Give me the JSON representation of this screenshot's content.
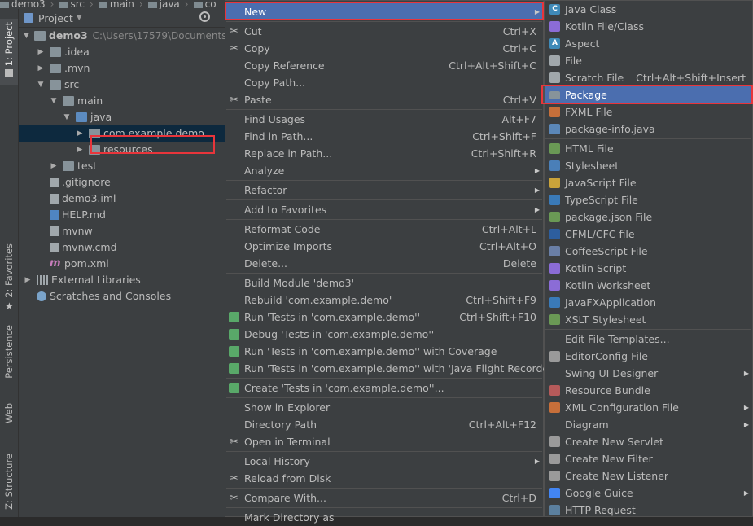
{
  "breadcrumb": [
    "demo3",
    "src",
    "main",
    "java",
    "co"
  ],
  "strip": {
    "project_tab": "1: Project",
    "favorites_tab": "2: Favorites",
    "persistence_tab": "Persistence",
    "web_tab": "Web",
    "structure_tab": "Z: Structure"
  },
  "panel": {
    "title": "Project"
  },
  "tree": [
    {
      "label": "demo3",
      "path": "C:\\Users\\17579\\Documents\\",
      "bold": true,
      "expanded": true,
      "icon": "folder-icon"
    },
    {
      "label": ".idea",
      "expanded": false,
      "icon": "folder-icon"
    },
    {
      "label": ".mvn",
      "expanded": false,
      "icon": "folder-icon"
    },
    {
      "label": "src",
      "expanded": true,
      "icon": "folder-icon"
    },
    {
      "label": "main",
      "expanded": true,
      "icon": "folder-icon"
    },
    {
      "label": "java",
      "expanded": true,
      "icon": "source-folder-icon"
    },
    {
      "label": "com.example.demo",
      "expanded": false,
      "icon": "package-icon",
      "selected": true
    },
    {
      "label": "resources",
      "expanded": false,
      "icon": "resources-folder-icon"
    },
    {
      "label": "test",
      "expanded": false,
      "icon": "folder-icon"
    },
    {
      "label": ".gitignore",
      "icon": "file-icon"
    },
    {
      "label": "demo3.iml",
      "icon": "file-icon"
    },
    {
      "label": "HELP.md",
      "icon": "markdown-icon"
    },
    {
      "label": "mvnw",
      "icon": "file-icon"
    },
    {
      "label": "mvnw.cmd",
      "icon": "file-icon"
    },
    {
      "label": "pom.xml",
      "icon": "maven-icon"
    },
    {
      "label": "External Libraries",
      "expanded": false,
      "icon": "library-icon"
    },
    {
      "label": "Scratches and Consoles",
      "icon": "scratch-icon"
    }
  ],
  "context_menu": [
    {
      "label": "New",
      "submenu": true,
      "highlighted": true
    },
    {
      "sep": true
    },
    {
      "label": "Cut",
      "shortcut": "Ctrl+X",
      "icon": "scissors-icon"
    },
    {
      "label": "Copy",
      "shortcut": "Ctrl+C",
      "icon": "copy-icon"
    },
    {
      "label": "Copy Reference",
      "shortcut": "Ctrl+Alt+Shift+C"
    },
    {
      "label": "Copy Path...",
      "shortcut": ""
    },
    {
      "label": "Paste",
      "shortcut": "Ctrl+V",
      "icon": "paste-icon"
    },
    {
      "sep": true
    },
    {
      "label": "Find Usages",
      "shortcut": "Alt+F7"
    },
    {
      "label": "Find in Path...",
      "shortcut": "Ctrl+Shift+F"
    },
    {
      "label": "Replace in Path...",
      "shortcut": "Ctrl+Shift+R"
    },
    {
      "label": "Analyze",
      "submenu": true
    },
    {
      "sep": true
    },
    {
      "label": "Refactor",
      "submenu": true
    },
    {
      "sep": true
    },
    {
      "label": "Add to Favorites",
      "submenu": true
    },
    {
      "sep": true
    },
    {
      "label": "Reformat Code",
      "shortcut": "Ctrl+Alt+L"
    },
    {
      "label": "Optimize Imports",
      "shortcut": "Ctrl+Alt+O"
    },
    {
      "label": "Delete...",
      "shortcut": "Delete"
    },
    {
      "sep": true
    },
    {
      "label": "Build Module 'demo3'",
      "shortcut": ""
    },
    {
      "label": "Rebuild 'com.example.demo'",
      "shortcut": "Ctrl+Shift+F9"
    },
    {
      "label": "Run 'Tests in 'com.example.demo''",
      "shortcut": "Ctrl+Shift+F10",
      "icon": "run-icon"
    },
    {
      "label": "Debug 'Tests in 'com.example.demo''",
      "icon": "debug-icon"
    },
    {
      "label": "Run 'Tests in 'com.example.demo'' with Coverage",
      "icon": "coverage-icon"
    },
    {
      "label": "Run 'Tests in 'com.example.demo'' with 'Java Flight Recorder'",
      "icon": "flight-recorder-icon"
    },
    {
      "sep": true
    },
    {
      "label": "Create 'Tests in 'com.example.demo''...",
      "icon": "create-config-icon"
    },
    {
      "sep": true
    },
    {
      "label": "Show in Explorer"
    },
    {
      "label": "Directory Path",
      "shortcut": "Ctrl+Alt+F12"
    },
    {
      "label": "Open in Terminal",
      "icon": "terminal-icon"
    },
    {
      "sep": true
    },
    {
      "label": "Local History",
      "submenu": true
    },
    {
      "label": "Reload from Disk",
      "icon": "reload-icon"
    },
    {
      "sep": true
    },
    {
      "label": "Compare With...",
      "shortcut": "Ctrl+D",
      "icon": "compare-icon"
    },
    {
      "sep": true
    },
    {
      "label": "Mark Directory as"
    }
  ],
  "new_submenu": [
    {
      "label": "Java Class",
      "icon": "java-class-icon"
    },
    {
      "label": "Kotlin File/Class",
      "icon": "kotlin-file-icon"
    },
    {
      "label": "Aspect",
      "icon": "aspect-icon"
    },
    {
      "label": "File",
      "icon": "file-icon"
    },
    {
      "label": "Scratch File",
      "shortcut": "Ctrl+Alt+Shift+Insert",
      "icon": "scratch-file-icon"
    },
    {
      "label": "Package",
      "icon": "package-icon",
      "highlighted": true
    },
    {
      "label": "FXML File",
      "icon": "fxml-icon"
    },
    {
      "label": "package-info.java",
      "icon": "java-file-icon"
    },
    {
      "sep": true
    },
    {
      "label": "HTML File",
      "icon": "html-icon"
    },
    {
      "label": "Stylesheet",
      "icon": "css-icon"
    },
    {
      "label": "JavaScript File",
      "icon": "javascript-icon"
    },
    {
      "label": "TypeScript File",
      "icon": "typescript-icon"
    },
    {
      "label": "package.json File",
      "icon": "npm-icon"
    },
    {
      "label": "CFML/CFC file",
      "icon": "cfml-icon"
    },
    {
      "label": "CoffeeScript File",
      "icon": "coffeescript-icon"
    },
    {
      "label": "Kotlin Script",
      "icon": "kotlin-script-icon"
    },
    {
      "label": "Kotlin Worksheet",
      "icon": "kotlin-worksheet-icon"
    },
    {
      "label": "JavaFXApplication",
      "icon": "javafx-icon"
    },
    {
      "label": "XSLT Stylesheet",
      "icon": "xslt-icon"
    },
    {
      "sep": true
    },
    {
      "label": "Edit File Templates..."
    },
    {
      "label": "EditorConfig File",
      "icon": "editorconfig-icon"
    },
    {
      "label": "Swing UI Designer",
      "submenu": true
    },
    {
      "label": "Resource Bundle",
      "icon": "resource-bundle-icon"
    },
    {
      "label": "XML Configuration File",
      "submenu": true,
      "icon": "xml-config-icon"
    },
    {
      "label": "Diagram",
      "submenu": true
    },
    {
      "label": "Create New Servlet",
      "icon": "servlet-icon"
    },
    {
      "label": "Create New Filter",
      "icon": "filter-icon"
    },
    {
      "label": "Create New Listener",
      "icon": "listener-icon"
    },
    {
      "label": "Google Guice",
      "submenu": true,
      "icon": "google-icon"
    },
    {
      "label": "HTTP Request",
      "icon": "api-icon"
    }
  ],
  "icon_colors": {
    "java-class-icon": "#3f8ab8",
    "kotlin-file-icon": "#8b6cd6",
    "aspect-icon": "#3f8ab8",
    "file-icon": "#a0a7ab",
    "scratch-file-icon": "#a0a7ab",
    "package-icon": "#87939a",
    "fxml-icon": "#c66f3a",
    "java-file-icon": "#5b87b8",
    "html-icon": "#6a9955",
    "css-icon": "#4a7fb8",
    "javascript-icon": "#c9a33a",
    "typescript-icon": "#3a7ab8",
    "npm-icon": "#6a9955",
    "cfml-icon": "#2d5e9e",
    "coffeescript-icon": "#6a7fa6",
    "kotlin-script-icon": "#8b6cd6",
    "kotlin-worksheet-icon": "#8b6cd6",
    "javafx-icon": "#3a7ab8",
    "xslt-icon": "#6a9955",
    "editorconfig-icon": "#9a9a9a",
    "resource-bundle-icon": "#b55a5a",
    "xml-config-icon": "#c66f3a",
    "servlet-icon": "#9a9a9a",
    "filter-icon": "#9a9a9a",
    "listener-icon": "#9a9a9a",
    "google-icon": "#4285f4",
    "api-icon": "#5b7f9e",
    "run-icon": "#59a869",
    "debug-icon": "#59a869",
    "coverage-icon": "#59a869",
    "flight-recorder-icon": "#59a869",
    "create-config-icon": "#59a869"
  },
  "accent": "#4b6eaf",
  "highlight_border": "#e8353b"
}
